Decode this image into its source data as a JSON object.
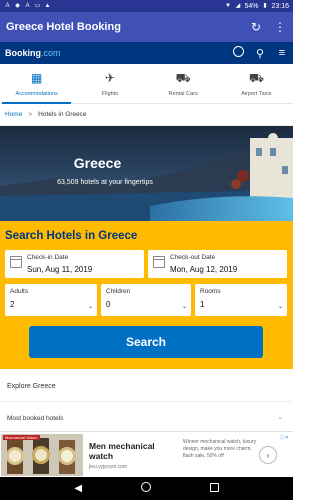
{
  "status_bar": {
    "left_icons": [
      "a-icon",
      "shield-icon",
      "a-icon",
      "card-icon",
      "warning-icon"
    ],
    "battery": "54%",
    "time": "23:16"
  },
  "app_bar": {
    "title": "Greece Hotel Booking",
    "actions": [
      "refresh-icon",
      "more-vert-icon"
    ]
  },
  "booking_bar": {
    "logo_main": "Booking",
    "logo_suffix": ".com",
    "icons": [
      "user-icon",
      "search-icon",
      "menu-icon"
    ]
  },
  "tabs": [
    {
      "label": "Accommodations",
      "icon": "hotel-icon",
      "active": true
    },
    {
      "label": "Flights",
      "icon": "plane-icon",
      "active": false
    },
    {
      "label": "Rental Cars",
      "icon": "car-icon",
      "active": false
    },
    {
      "label": "Airport Taxis",
      "icon": "taxi-icon",
      "active": false
    }
  ],
  "breadcrumb": {
    "home": "Home",
    "separator": ">",
    "current": "Hotels in Greece"
  },
  "hero": {
    "title": "Greece",
    "subtitle": "63,509 hotels at your fingertips"
  },
  "search": {
    "title": "Search Hotels in Greece",
    "checkin": {
      "label": "Check-in Date",
      "value": "Sun, Aug 11, 2019"
    },
    "checkout": {
      "label": "Check-out Date",
      "value": "Mon, Aug 12, 2019"
    },
    "adults": {
      "label": "Adults",
      "value": "2"
    },
    "children": {
      "label": "Children",
      "value": "0"
    },
    "rooms": {
      "label": "Rooms",
      "value": "1"
    },
    "button": "Search"
  },
  "explore": {
    "heading": "Explore Greece",
    "most_booked": "Most booked hotels"
  },
  "ad": {
    "badge": "Mechanical Watch",
    "title": "Men mechanical watch",
    "source": "jieu.yyjpxym.com",
    "description": "Winner mechanical watch, luxury design, make you more charm, flash sale, 50% off"
  },
  "colors": {
    "status_bar": "#283593",
    "app_bar": "#3f51b5",
    "booking_blue": "#003580",
    "accent_blue": "#0071c2",
    "search_yellow": "#febb02"
  }
}
